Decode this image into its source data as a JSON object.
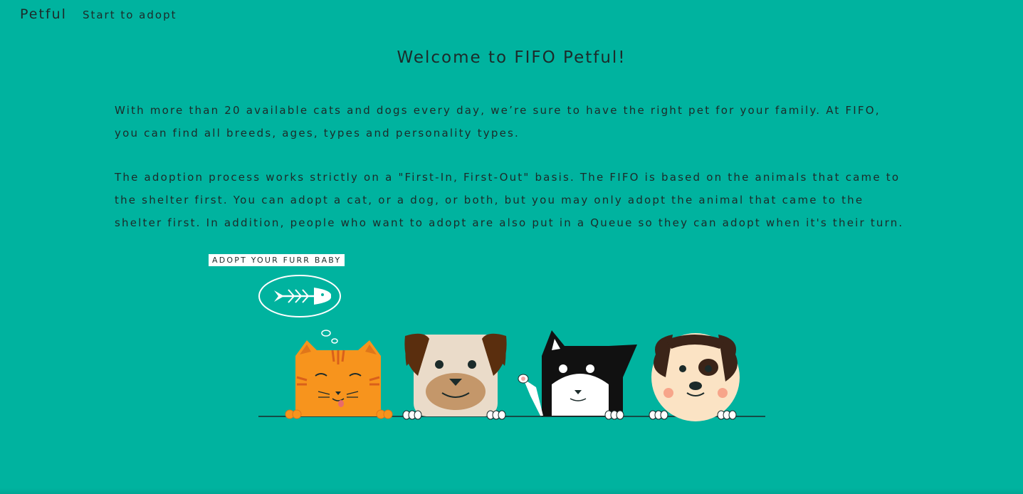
{
  "nav": {
    "brand": "Petful",
    "adopt_link": "Start to adopt"
  },
  "main": {
    "title": "Welcome to FIFO Petful!",
    "paragraph1": "With more than 20 available cats and dogs every day, we’re sure to have the right pet for your family. At FIFO, you can find all breeds, ages, types and personality types.",
    "paragraph2": "The adoption process works strictly on a \"First-In, First-Out\" basis. The FIFO is based on the animals that came to the shelter first. You can adopt a cat, or a dog, or both, but you may only adopt the animal that came to the shelter first. In addition, people who want to adopt are also put in a Queue so they can adopt when it's their turn.",
    "adopt_button": "ADOPT YOUR FURR BABY"
  },
  "illustration": {
    "animals": [
      "orange-cat",
      "pug-dog",
      "tuxedo-cat",
      "spotted-dog"
    ],
    "icon": "fish-bone-thought-bubble"
  },
  "colors": {
    "background": "#00b39f",
    "text": "#1c2b2a",
    "button_bg": "#ffffff"
  }
}
